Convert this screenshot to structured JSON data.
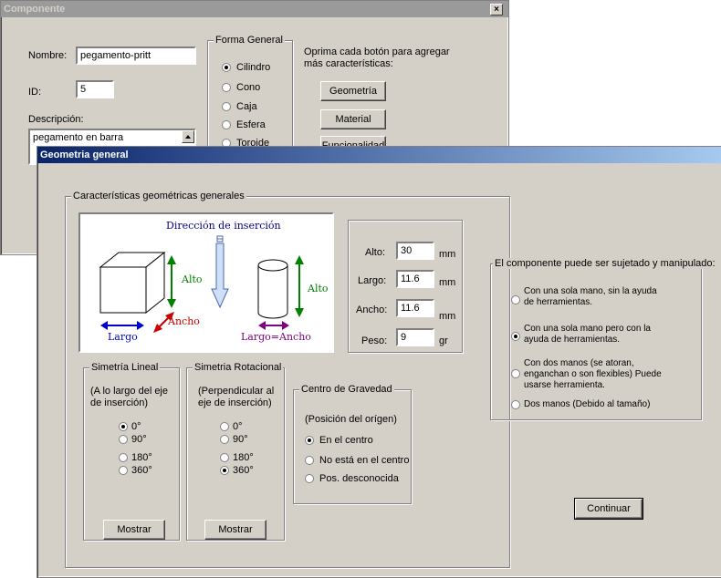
{
  "back_window": {
    "title": "Componente",
    "close_symbol": "×",
    "nombre_label": "Nombre:",
    "nombre_value": "pegamento-pritt",
    "id_label": "ID:",
    "id_value": "5",
    "descripcion_label": "Descripción:",
    "descripcion_value": "pegamento en barra",
    "forma_general": {
      "legend": "Forma General",
      "options": [
        "Cilindro",
        "Cono",
        "Caja",
        "Esfera",
        "Toroide"
      ],
      "selected": "Cilindro"
    },
    "instruction_line1": "Oprima cada botón para agregar",
    "instruction_line2": "más características:",
    "buttons": [
      "Geometría",
      "Material",
      "Funcionalidad"
    ]
  },
  "front_window": {
    "title": "Geometria general",
    "geometric_group_legend": "Características geométricas generales",
    "illustration": {
      "insertion_direction": "Dirección de inserción",
      "cube_height": "Alto",
      "cube_width": "Ancho",
      "cube_length": "Largo",
      "cylinder_height": "Alto",
      "cylinder_length": "Largo=Ancho"
    },
    "dimensions": {
      "alto_label": "Alto:",
      "alto_value": "30",
      "alto_unit": "mm",
      "largo_label": "Largo:",
      "largo_value": "11.6",
      "largo_unit": "mm",
      "ancho_label": "Ancho:",
      "ancho_value": "11.6",
      "ancho_unit": "mm",
      "peso_label": "Peso:",
      "peso_value": "9",
      "peso_unit": "gr"
    },
    "simetria_lineal": {
      "legend": "Simetría Lineal",
      "desc_line1": "(A lo largo del eje",
      "desc_line2": "de inserción)",
      "options": [
        "0°",
        "90°",
        "180°",
        "360°"
      ],
      "selected": "0°",
      "button": "Mostrar"
    },
    "simetria_rotacional": {
      "legend": "Simetria Rotacional",
      "desc_line1": "(Perpendicular al",
      "desc_line2": "eje de inserción)",
      "options": [
        "0°",
        "90°",
        "180°",
        "360°"
      ],
      "selected": "360°",
      "button": "Mostrar"
    },
    "centro_gravedad": {
      "legend": "Centro de Gravedad",
      "desc": "(Posición del orígen)",
      "options": [
        "En el centro",
        "No está en el centro",
        "Pos. desconocida"
      ],
      "selected": "En el centro"
    },
    "manipulation": {
      "legend": "El componente puede ser sujetado y manipulado:",
      "options": [
        {
          "line1": "Con una sola mano, sin la ayuda",
          "line2": "de herramientas.",
          "line3": ""
        },
        {
          "line1": "Con una sola mano pero con la",
          "line2": "ayuda de herramientas.",
          "line3": ""
        },
        {
          "line1": "Con dos manos (se atoran,",
          "line2": "enganchan o son flexibles) Puede",
          "line3": "usarse herramienta."
        },
        {
          "line1": "Dos manos (Debido al tamaño)",
          "line2": "",
          "line3": ""
        }
      ],
      "selected_index": 1
    },
    "continue_button": "Continuar"
  }
}
